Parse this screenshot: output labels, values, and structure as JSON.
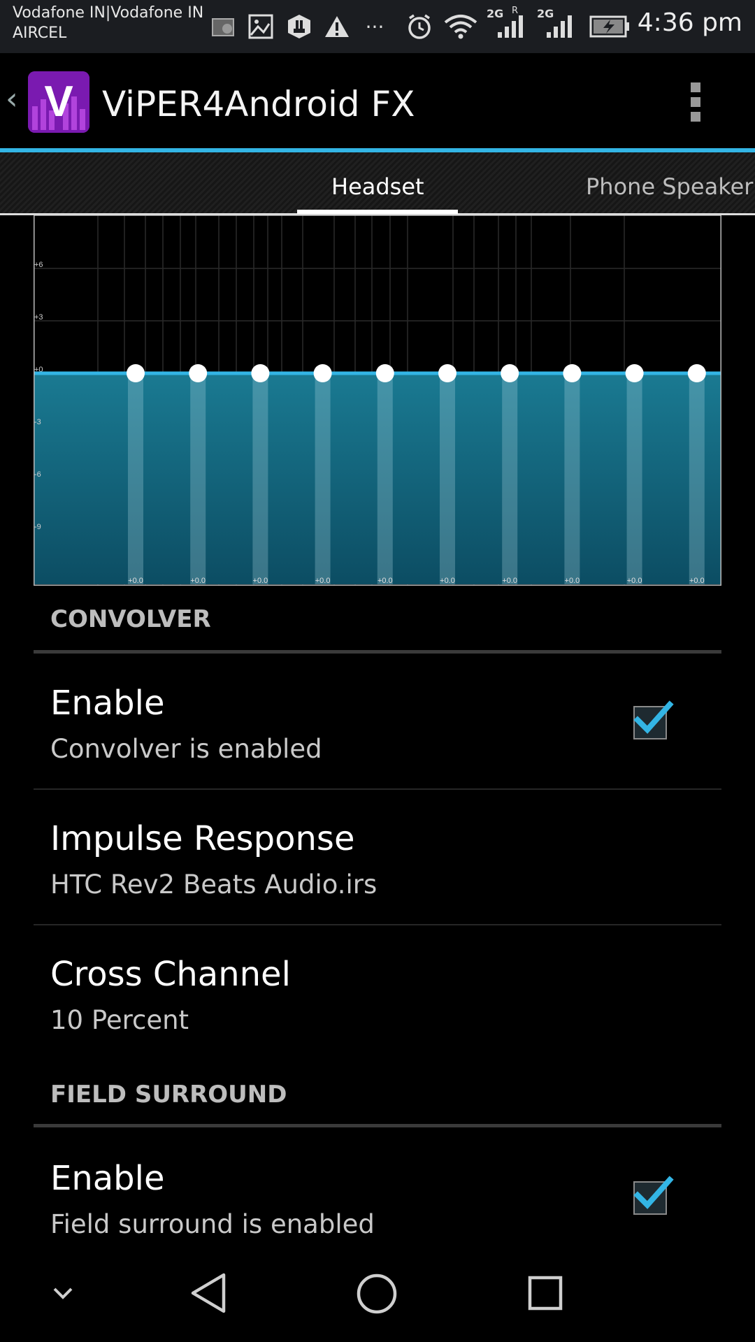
{
  "status_bar": {
    "carrier_line1": "Vodafone IN|Vodafone IN",
    "carrier_line2": "AIRCEL",
    "network_1": "2G",
    "roaming": "R",
    "network_2": "2G",
    "time": "4:36 pm",
    "icons": [
      "photo-icon",
      "image-icon",
      "hand-icon",
      "warning-icon",
      "more-icon",
      "alarm-icon",
      "wifi-icon",
      "signal-icon",
      "signal-icon",
      "battery-charging-icon"
    ]
  },
  "action_bar": {
    "title": "ViPER4Android FX",
    "icon_letter": "V"
  },
  "tabs": [
    {
      "label": "Headset",
      "selected": true
    },
    {
      "label": "Phone Speaker",
      "selected": false
    }
  ],
  "equalizer": {
    "y_ticks": [
      "+6",
      "+3",
      "+0",
      "-3",
      "-6",
      "-9"
    ],
    "bands": [
      "+0.0",
      "+0.0",
      "+0.0",
      "+0.0",
      "+0.0",
      "+0.0",
      "+0.0",
      "+0.0",
      "+0.0",
      "+0.0"
    ],
    "band_gains_db": [
      0,
      0,
      0,
      0,
      0,
      0,
      0,
      0,
      0,
      0
    ],
    "fill_color": "#12677e",
    "accent_color": "#33b5e5"
  },
  "convolver": {
    "header": "CONVOLVER",
    "enable_title": "Enable",
    "enable_summary": "Convolver is enabled",
    "enabled": true,
    "impulse_title": "Impulse Response",
    "impulse_value": "HTC Rev2 Beats Audio.irs",
    "cross_title": "Cross Channel",
    "cross_value": "10 Percent"
  },
  "field_surround": {
    "header": "FIELD SURROUND",
    "enable_title": "Enable",
    "enable_summary": "Field surround is enabled",
    "enabled": true
  }
}
